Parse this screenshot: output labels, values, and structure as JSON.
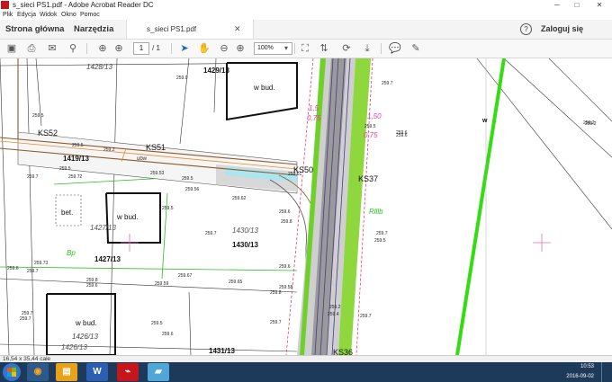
{
  "window": {
    "title": "s_sieci PS1.pdf - Adobe Acrobat Reader DC"
  },
  "menu": [
    "Plik",
    "Edycja",
    "Widok",
    "Okno",
    "Pomoc"
  ],
  "nav": {
    "home": "Strona główna",
    "tools": "Narzędzia",
    "doc_tab": "s_sieci PS1.pdf",
    "signin": "Zaloguj się",
    "help": "?"
  },
  "toolbar": {
    "page_current": "1",
    "page_total": "/ 1",
    "zoom": "100%"
  },
  "status": {
    "dimensions": "16,54 x 35,44 cale"
  },
  "clock": {
    "time": "10:53",
    "date": "2016-09-02"
  },
  "map": {
    "parcels": [
      "1428/13",
      "1429/13",
      "1419/13",
      "1427/13",
      "1430/13",
      "1426/13",
      "1431/13"
    ],
    "parcels_faint": [
      "1427/13",
      "1430/13",
      "1426/13"
    ],
    "buildings": [
      "w bud.",
      "w bud.",
      "w bud."
    ],
    "bet": "bet.",
    "wells": [
      "KS52",
      "KS51",
      "KS50",
      "KS37",
      "KS36"
    ],
    "labels": {
      "bp": "Bp",
      "rilib": "Rlllb",
      "w": "w",
      "ubw": "ubw"
    },
    "elevations": [
      "259.0",
      "259.5",
      "259.7",
      "259.5",
      "259.2",
      "259.6",
      "259.5",
      "259.7",
      "259.2",
      "259.5",
      "259.72",
      "259.53",
      "259.5",
      "259.56",
      "259.62",
      "259.61",
      "259.73",
      "259.7",
      "259.6",
      "259.7",
      "259.8",
      "259.6",
      "259.59",
      "259.67",
      "259.65",
      "259.5",
      "259.8",
      "259.7",
      "259.6",
      "259.8",
      "259.6",
      "259.58",
      "259.7",
      "259.5",
      "259.2",
      "259.4",
      "259.7",
      "259.6",
      "259.5",
      "259.6",
      "259.7",
      "259.7",
      "259.2"
    ],
    "pink": [
      "1,5",
      "0,75",
      "1,50",
      "0,75"
    ]
  },
  "colors": {
    "acrobat_red": "#c4161c",
    "map_green": "#33dd11",
    "road_gray": "#7a7a7a",
    "pink": "#e83ea0",
    "taskbar": "#1e3a5a"
  }
}
